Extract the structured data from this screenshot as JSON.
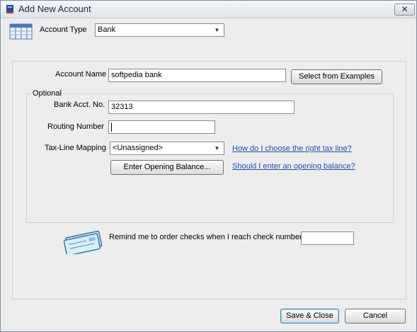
{
  "window": {
    "title": "Add New Account",
    "close_symbol": "✕"
  },
  "account_type": {
    "label": "Account Type",
    "value": "Bank"
  },
  "account_name": {
    "label": "Account Name",
    "value": "softpedia bank",
    "examples_button": "Select from Examples"
  },
  "optional": {
    "group_label": "Optional",
    "bank_acct_label": "Bank Acct. No.",
    "bank_acct_value": "32313",
    "routing_label": "Routing Number",
    "routing_value": "",
    "tax_line_label": "Tax-Line Mapping",
    "tax_line_value": "<Unassigned>",
    "tax_help_link": "How do I choose the right tax line?",
    "opening_balance_button": "Enter Opening Balance...",
    "opening_help_link": "Should I enter an opening balance?"
  },
  "checks": {
    "label": "Remind me to order checks when I reach check number",
    "value": ""
  },
  "footer": {
    "save_label": "Save & Close",
    "cancel_label": "Cancel"
  },
  "icons": {
    "title": "app-icon",
    "account_type": "ledger-icon",
    "checks": "check-icon",
    "dropdown": "chevron-down-icon"
  },
  "colors": {
    "link": "#1f4fb5",
    "window_bg": "#ececec"
  }
}
